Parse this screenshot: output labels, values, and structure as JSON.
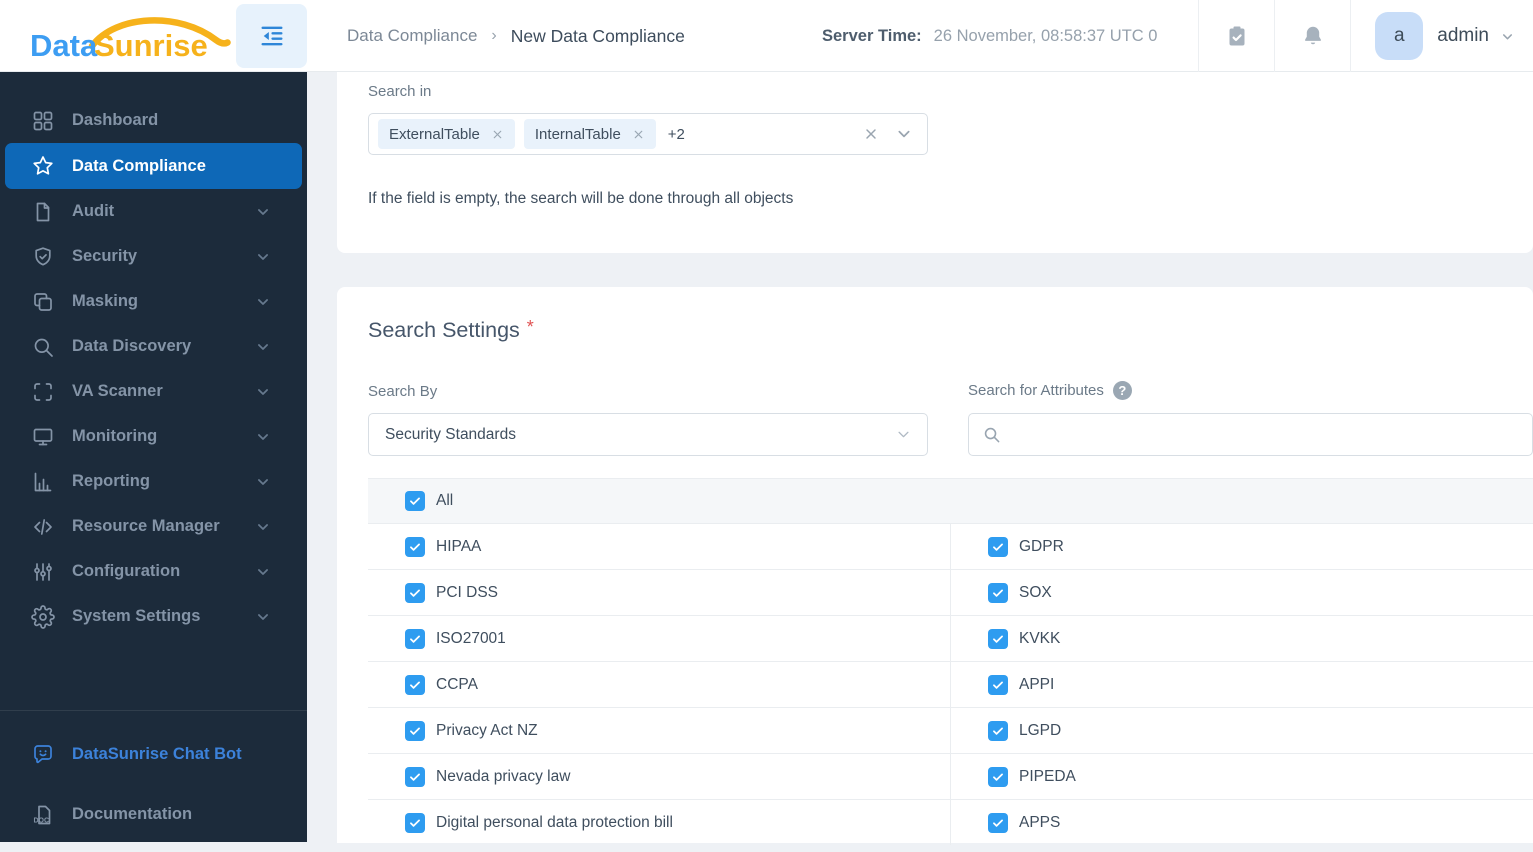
{
  "brand": {
    "word1": "Data",
    "word2": "Sunrise"
  },
  "header": {
    "breadcrumb_parent": "Data Compliance",
    "breadcrumb_separator": "›",
    "breadcrumb_current": "New Data Compliance",
    "server_time_label": "Server Time:",
    "server_time_value": "26 November, 08:58:37  UTC 0",
    "user": {
      "avatar_initial": "a",
      "name": "admin"
    }
  },
  "sidebar": {
    "items": [
      {
        "label": "Dashboard",
        "icon": "dashboard-icon",
        "chevron": false,
        "active": false
      },
      {
        "label": "Data Compliance",
        "icon": "star-icon",
        "chevron": false,
        "active": true
      },
      {
        "label": "Audit",
        "icon": "file-icon",
        "chevron": true,
        "active": false
      },
      {
        "label": "Security",
        "icon": "shield-check-icon",
        "chevron": true,
        "active": false
      },
      {
        "label": "Masking",
        "icon": "masking-icon",
        "chevron": true,
        "active": false
      },
      {
        "label": "Data Discovery",
        "icon": "search-icon",
        "chevron": true,
        "active": false
      },
      {
        "label": "VA Scanner",
        "icon": "scanner-icon",
        "chevron": true,
        "active": false
      },
      {
        "label": "Monitoring",
        "icon": "monitor-icon",
        "chevron": true,
        "active": false
      },
      {
        "label": "Reporting",
        "icon": "bar-chart-icon",
        "chevron": true,
        "active": false
      },
      {
        "label": "Resource Manager",
        "icon": "code-icon",
        "chevron": true,
        "active": false
      },
      {
        "label": "Configuration",
        "icon": "sliders-icon",
        "chevron": true,
        "active": false
      },
      {
        "label": "System Settings",
        "icon": "gear-icon",
        "chevron": true,
        "active": false
      }
    ],
    "footer_items": [
      {
        "label": "DataSunrise Chat Bot",
        "icon": "chat-bot-icon",
        "highlight": true
      },
      {
        "label": "Documentation",
        "icon": "doc-icon",
        "highlight": false
      }
    ]
  },
  "search_in": {
    "label": "Search in",
    "tags": [
      "ExternalTable",
      "InternalTable"
    ],
    "more_count": "+2",
    "hint": "If the field is empty, the search will be done through all objects"
  },
  "search_settings": {
    "title": "Search Settings",
    "required_mark": "*",
    "search_by_label": "Search By",
    "search_by_value": "Security Standards",
    "attributes_label": "Search for Attributes",
    "attributes_placeholder": "",
    "help_glyph": "?"
  },
  "standards": {
    "all_label": "All",
    "all_checked": true,
    "checked": true,
    "rows": [
      [
        "HIPAA",
        "GDPR"
      ],
      [
        "PCI DSS",
        "SOX"
      ],
      [
        "ISO27001",
        "KVKK"
      ],
      [
        "CCPA",
        "APPI"
      ],
      [
        "Privacy Act NZ",
        "LGPD"
      ],
      [
        "Nevada privacy law",
        "PIPEDA"
      ],
      [
        "Digital personal data protection bill",
        "APPS"
      ]
    ]
  },
  "colors": {
    "sidebar_bg": "#1c2b3b",
    "active_item_blue": "#0e68b7",
    "checkbox_blue": "#2e9cf0",
    "link_blue": "#3c82da",
    "logo_blue": "#3d9df2",
    "logo_orange": "#f6b21b",
    "tag_bg": "#e9f2fb",
    "required_red": "#e05252"
  }
}
